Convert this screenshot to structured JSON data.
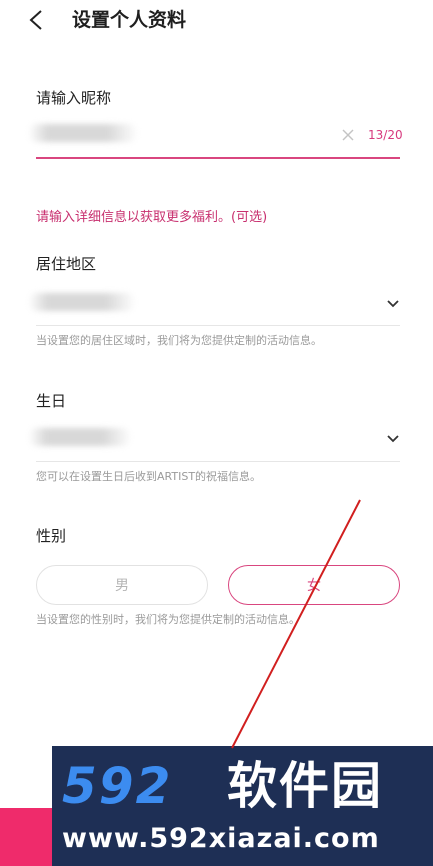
{
  "header": {
    "title": "设置个人资料",
    "back_icon": "chevron-left-icon"
  },
  "nickname": {
    "label": "请输入昵称",
    "counter": "13/20",
    "clear_icon": "close-icon"
  },
  "promo_text": "请输入详细信息以获取更多福利。(可选)",
  "region": {
    "label": "居住地区",
    "hint": "当设置您的居住区域时，我们将为您提供定制的活动信息。",
    "dropdown_icon": "chevron-down-icon"
  },
  "birthday": {
    "label": "生日",
    "hint": "您可以在设置生日后收到ARTIST的祝福信息。",
    "dropdown_icon": "chevron-down-icon"
  },
  "gender": {
    "label": "性别",
    "male": "男",
    "female": "女",
    "selected": "女",
    "hint": "当设置您的性别时，我们将为您提供定制的活动信息。"
  },
  "watermark": {
    "logo": "592",
    "name": "软件园",
    "url": "www.592xiazai.com"
  },
  "colors": {
    "accent": "#d9467f",
    "promo": "#c8306f",
    "hint": "#9a9a9a",
    "watermark_bg": "#1e2f55",
    "watermark_logo": "#3c8cf0",
    "corner_block": "#ef2b6b",
    "annotation_line": "#d11f1f"
  }
}
